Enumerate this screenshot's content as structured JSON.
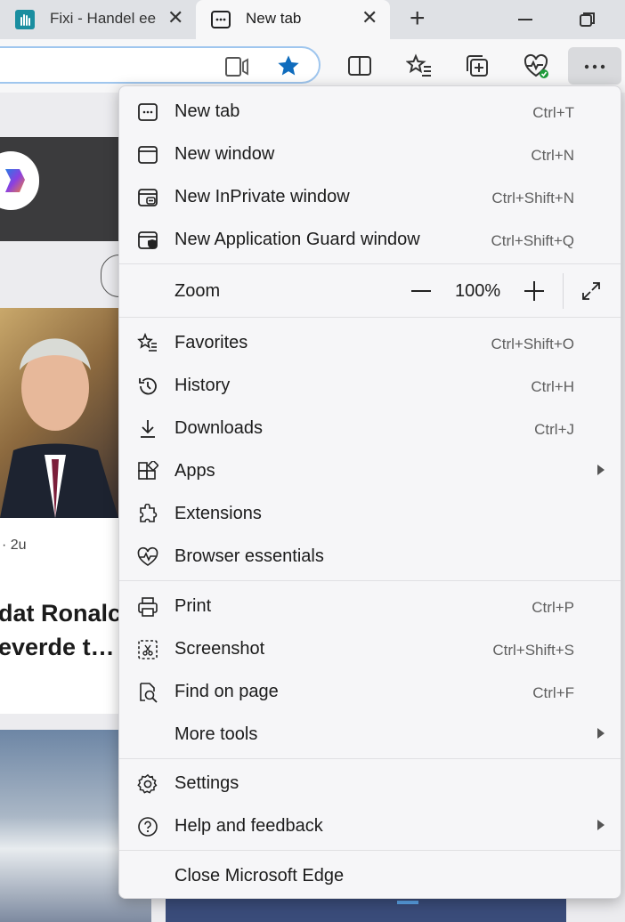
{
  "tabs": [
    {
      "title": "Fixi - Handel ee",
      "icon": "fixi-hand-icon"
    },
    {
      "title": "New tab",
      "icon": "new-tab-icon"
    }
  ],
  "page_text": {
    "time": "· 2u",
    "headline_line1": "dat Ronalc",
    "headline_line2": "everde t…"
  },
  "menu": {
    "zoom": {
      "label": "Zoom",
      "value": "100%"
    },
    "items": [
      {
        "id": "new-tab",
        "label": "New tab",
        "shortcut": "Ctrl+T",
        "icon": "new-tab-icon"
      },
      {
        "id": "new-window",
        "label": "New window",
        "shortcut": "Ctrl+N",
        "icon": "window-icon"
      },
      {
        "id": "new-inprivate",
        "label": "New InPrivate window",
        "shortcut": "Ctrl+Shift+N",
        "icon": "inprivate-icon"
      },
      {
        "id": "new-app-guard",
        "label": "New Application Guard window",
        "shortcut": "Ctrl+Shift+Q",
        "icon": "application-guard-icon"
      },
      {
        "id": "favorites",
        "label": "Favorites",
        "shortcut": "Ctrl+Shift+O",
        "icon": "favorites-icon"
      },
      {
        "id": "history",
        "label": "History",
        "shortcut": "Ctrl+H",
        "icon": "history-icon"
      },
      {
        "id": "downloads",
        "label": "Downloads",
        "shortcut": "Ctrl+J",
        "icon": "download-icon"
      },
      {
        "id": "apps",
        "label": "Apps",
        "shortcut": "",
        "icon": "apps-icon"
      },
      {
        "id": "extensions",
        "label": "Extensions",
        "shortcut": "",
        "icon": "extensions-icon"
      },
      {
        "id": "browser-essentials",
        "label": "Browser essentials",
        "shortcut": "",
        "icon": "heartbeat-icon"
      },
      {
        "id": "print",
        "label": "Print",
        "shortcut": "Ctrl+P",
        "icon": "printer-icon"
      },
      {
        "id": "screenshot",
        "label": "Screenshot",
        "shortcut": "Ctrl+Shift+S",
        "icon": "screenshot-icon"
      },
      {
        "id": "find",
        "label": "Find on page",
        "shortcut": "Ctrl+F",
        "icon": "find-icon"
      },
      {
        "id": "more-tools",
        "label": "More tools",
        "shortcut": "",
        "icon": ""
      },
      {
        "id": "settings",
        "label": "Settings",
        "shortcut": "",
        "icon": "gear-icon"
      },
      {
        "id": "help",
        "label": "Help and feedback",
        "shortcut": "",
        "icon": "help-icon"
      },
      {
        "id": "close",
        "label": "Close Microsoft Edge",
        "shortcut": "",
        "icon": ""
      }
    ]
  },
  "colors": {
    "highlight": "#f0f000",
    "accent": "#0f6cbd"
  }
}
